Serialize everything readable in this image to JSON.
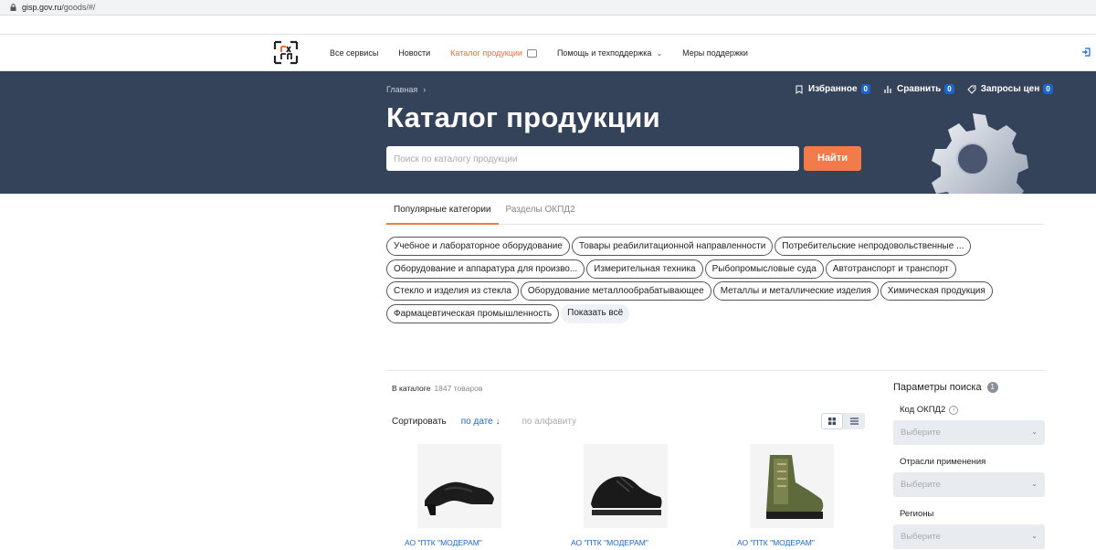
{
  "browser": {
    "url_domain": "gisp.gov.ru",
    "url_path": "/goods/#/"
  },
  "logo_text": "ГИСП",
  "nav": {
    "items": [
      "Все сервисы",
      "Новости",
      "Каталог продукции",
      "Помощь и техподдержка",
      "Меры поддержки"
    ]
  },
  "hero": {
    "breadcrumb": "Главная",
    "title": "Каталог продукции",
    "search_placeholder": "Поиск по каталогу продукции",
    "search_button": "Найти",
    "counters": [
      {
        "label": "Избранное",
        "count": "0"
      },
      {
        "label": "Сравнить",
        "count": "0"
      },
      {
        "label": "Запросы цен",
        "count": "0"
      }
    ]
  },
  "tabs": [
    "Популярные категории",
    "Разделы ОКПД2"
  ],
  "chips": [
    [
      "Учебное и лабораторное оборудование",
      "Товары реабилитационной направленности",
      "Потребительские непродовольственные ..."
    ],
    [
      "Оборудование и аппаратура для произво...",
      "Измерительная техника",
      "Рыбопромысловые суда",
      "Автотранспорт и транспорт"
    ],
    [
      "Стекло и изделия из стекла",
      "Оборудование металлообрабатывающее",
      "Металлы и металлические изделия",
      "Химическая продукция"
    ],
    [
      "Фармацевтическая промышленность",
      "Показать всё"
    ]
  ],
  "catalog": {
    "label": "В каталоге",
    "count": "1847 товаров"
  },
  "sort": {
    "label": "Сортировать",
    "by_date": "по дате",
    "by_alpha": "по алфавиту"
  },
  "products": [
    {
      "maker": "АО \"ПТК \"МОДЕРАМ\"",
      "kind": "shoe-pump"
    },
    {
      "maker": "АО \"ПТК \"МОДЕРАМ\"",
      "kind": "shoe-sneaker"
    },
    {
      "maker": "АО \"ПТК \"МОДЕРАМ\"",
      "kind": "boot-khaki"
    }
  ],
  "filters": {
    "title": "Параметры поиска",
    "badge": "1",
    "groups": [
      {
        "label": "Код ОКПД2",
        "placeholder": "Выберите"
      },
      {
        "label": "Отрасли применения",
        "placeholder": "Выберите"
      },
      {
        "label": "Регионы",
        "placeholder": "Выберите"
      }
    ]
  },
  "colors": {
    "hero_bg": "#34425a",
    "accent": "#f37a4b",
    "link": "#1b66c9"
  }
}
